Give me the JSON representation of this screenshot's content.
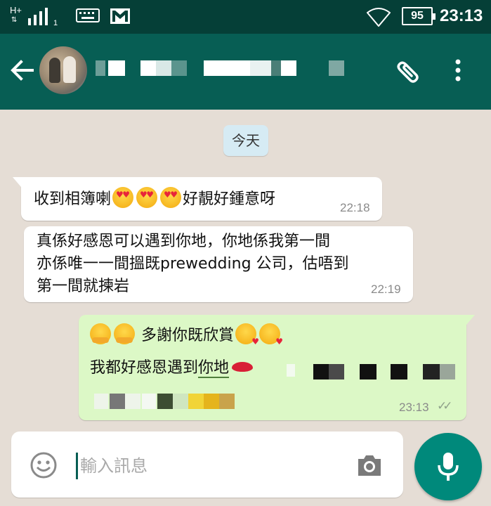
{
  "status_bar": {
    "network_type": "H+",
    "sim_slot": "1",
    "battery_level": "95",
    "time": "23:13",
    "icons": [
      "data-arrows-icon",
      "signal-icon",
      "keyboard-icon",
      "gmail-icon",
      "wifi-icon",
      "battery-icon"
    ]
  },
  "app_bar": {
    "icons": [
      "back-arrow-icon",
      "contact-avatar",
      "attachment-icon",
      "more-options-icon"
    ]
  },
  "chat": {
    "date_divider": "今天",
    "messages": [
      {
        "direction": "incoming",
        "line1_before": "收到相簿喇",
        "line1_after": "好靚好鍾意呀",
        "emojis": [
          "heart-eyes-emoji",
          "heart-eyes-emoji",
          "heart-eyes-emoji"
        ],
        "time": "22:18"
      },
      {
        "direction": "incoming",
        "lines": [
          "真係好感恩可以遇到你地，你地係我第一間",
          "亦係唯一一間搵既prewedding 公司，估唔到",
          "第一間就揀岩"
        ],
        "time": "22:19"
      },
      {
        "direction": "outgoing",
        "line1": "多謝你既欣賞",
        "line2_before": "我都好感恩遇到",
        "line2_link": "你地",
        "emojis": [
          "hugging-emoji",
          "hugging-emoji",
          "face-blowing-kiss-emoji",
          "face-blowing-kiss-emoji",
          "kiss-mark-emoji"
        ],
        "time": "23:13",
        "status": "read"
      }
    ]
  },
  "composer": {
    "placeholder": "輸入訊息",
    "icons": [
      "emoji-icon",
      "camera-icon",
      "microphone-icon"
    ]
  },
  "colors": {
    "status_bar": "#053f37",
    "app_bar": "#075e54",
    "outgoing_bubble": "#dcf8c6",
    "incoming_bubble": "#ffffff",
    "date_chip": "#d6ebf4",
    "mic_button": "#00897b",
    "chat_background": "#e5ddd5"
  }
}
